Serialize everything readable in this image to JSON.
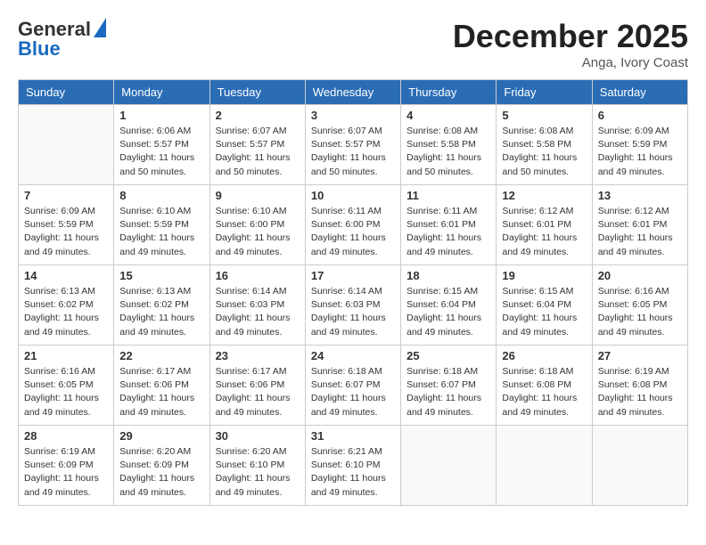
{
  "header": {
    "logo_line1": "General",
    "logo_line2": "Blue",
    "month": "December 2025",
    "location": "Anga, Ivory Coast"
  },
  "days_of_week": [
    "Sunday",
    "Monday",
    "Tuesday",
    "Wednesday",
    "Thursday",
    "Friday",
    "Saturday"
  ],
  "weeks": [
    [
      {
        "day": "",
        "info": ""
      },
      {
        "day": "1",
        "info": "Sunrise: 6:06 AM\nSunset: 5:57 PM\nDaylight: 11 hours\nand 50 minutes."
      },
      {
        "day": "2",
        "info": "Sunrise: 6:07 AM\nSunset: 5:57 PM\nDaylight: 11 hours\nand 50 minutes."
      },
      {
        "day": "3",
        "info": "Sunrise: 6:07 AM\nSunset: 5:57 PM\nDaylight: 11 hours\nand 50 minutes."
      },
      {
        "day": "4",
        "info": "Sunrise: 6:08 AM\nSunset: 5:58 PM\nDaylight: 11 hours\nand 50 minutes."
      },
      {
        "day": "5",
        "info": "Sunrise: 6:08 AM\nSunset: 5:58 PM\nDaylight: 11 hours\nand 50 minutes."
      },
      {
        "day": "6",
        "info": "Sunrise: 6:09 AM\nSunset: 5:59 PM\nDaylight: 11 hours\nand 49 minutes."
      }
    ],
    [
      {
        "day": "7",
        "info": "Sunrise: 6:09 AM\nSunset: 5:59 PM\nDaylight: 11 hours\nand 49 minutes."
      },
      {
        "day": "8",
        "info": "Sunrise: 6:10 AM\nSunset: 5:59 PM\nDaylight: 11 hours\nand 49 minutes."
      },
      {
        "day": "9",
        "info": "Sunrise: 6:10 AM\nSunset: 6:00 PM\nDaylight: 11 hours\nand 49 minutes."
      },
      {
        "day": "10",
        "info": "Sunrise: 6:11 AM\nSunset: 6:00 PM\nDaylight: 11 hours\nand 49 minutes."
      },
      {
        "day": "11",
        "info": "Sunrise: 6:11 AM\nSunset: 6:01 PM\nDaylight: 11 hours\nand 49 minutes."
      },
      {
        "day": "12",
        "info": "Sunrise: 6:12 AM\nSunset: 6:01 PM\nDaylight: 11 hours\nand 49 minutes."
      },
      {
        "day": "13",
        "info": "Sunrise: 6:12 AM\nSunset: 6:01 PM\nDaylight: 11 hours\nand 49 minutes."
      }
    ],
    [
      {
        "day": "14",
        "info": "Sunrise: 6:13 AM\nSunset: 6:02 PM\nDaylight: 11 hours\nand 49 minutes."
      },
      {
        "day": "15",
        "info": "Sunrise: 6:13 AM\nSunset: 6:02 PM\nDaylight: 11 hours\nand 49 minutes."
      },
      {
        "day": "16",
        "info": "Sunrise: 6:14 AM\nSunset: 6:03 PM\nDaylight: 11 hours\nand 49 minutes."
      },
      {
        "day": "17",
        "info": "Sunrise: 6:14 AM\nSunset: 6:03 PM\nDaylight: 11 hours\nand 49 minutes."
      },
      {
        "day": "18",
        "info": "Sunrise: 6:15 AM\nSunset: 6:04 PM\nDaylight: 11 hours\nand 49 minutes."
      },
      {
        "day": "19",
        "info": "Sunrise: 6:15 AM\nSunset: 6:04 PM\nDaylight: 11 hours\nand 49 minutes."
      },
      {
        "day": "20",
        "info": "Sunrise: 6:16 AM\nSunset: 6:05 PM\nDaylight: 11 hours\nand 49 minutes."
      }
    ],
    [
      {
        "day": "21",
        "info": "Sunrise: 6:16 AM\nSunset: 6:05 PM\nDaylight: 11 hours\nand 49 minutes."
      },
      {
        "day": "22",
        "info": "Sunrise: 6:17 AM\nSunset: 6:06 PM\nDaylight: 11 hours\nand 49 minutes."
      },
      {
        "day": "23",
        "info": "Sunrise: 6:17 AM\nSunset: 6:06 PM\nDaylight: 11 hours\nand 49 minutes."
      },
      {
        "day": "24",
        "info": "Sunrise: 6:18 AM\nSunset: 6:07 PM\nDaylight: 11 hours\nand 49 minutes."
      },
      {
        "day": "25",
        "info": "Sunrise: 6:18 AM\nSunset: 6:07 PM\nDaylight: 11 hours\nand 49 minutes."
      },
      {
        "day": "26",
        "info": "Sunrise: 6:18 AM\nSunset: 6:08 PM\nDaylight: 11 hours\nand 49 minutes."
      },
      {
        "day": "27",
        "info": "Sunrise: 6:19 AM\nSunset: 6:08 PM\nDaylight: 11 hours\nand 49 minutes."
      }
    ],
    [
      {
        "day": "28",
        "info": "Sunrise: 6:19 AM\nSunset: 6:09 PM\nDaylight: 11 hours\nand 49 minutes."
      },
      {
        "day": "29",
        "info": "Sunrise: 6:20 AM\nSunset: 6:09 PM\nDaylight: 11 hours\nand 49 minutes."
      },
      {
        "day": "30",
        "info": "Sunrise: 6:20 AM\nSunset: 6:10 PM\nDaylight: 11 hours\nand 49 minutes."
      },
      {
        "day": "31",
        "info": "Sunrise: 6:21 AM\nSunset: 6:10 PM\nDaylight: 11 hours\nand 49 minutes."
      },
      {
        "day": "",
        "info": ""
      },
      {
        "day": "",
        "info": ""
      },
      {
        "day": "",
        "info": ""
      }
    ]
  ]
}
